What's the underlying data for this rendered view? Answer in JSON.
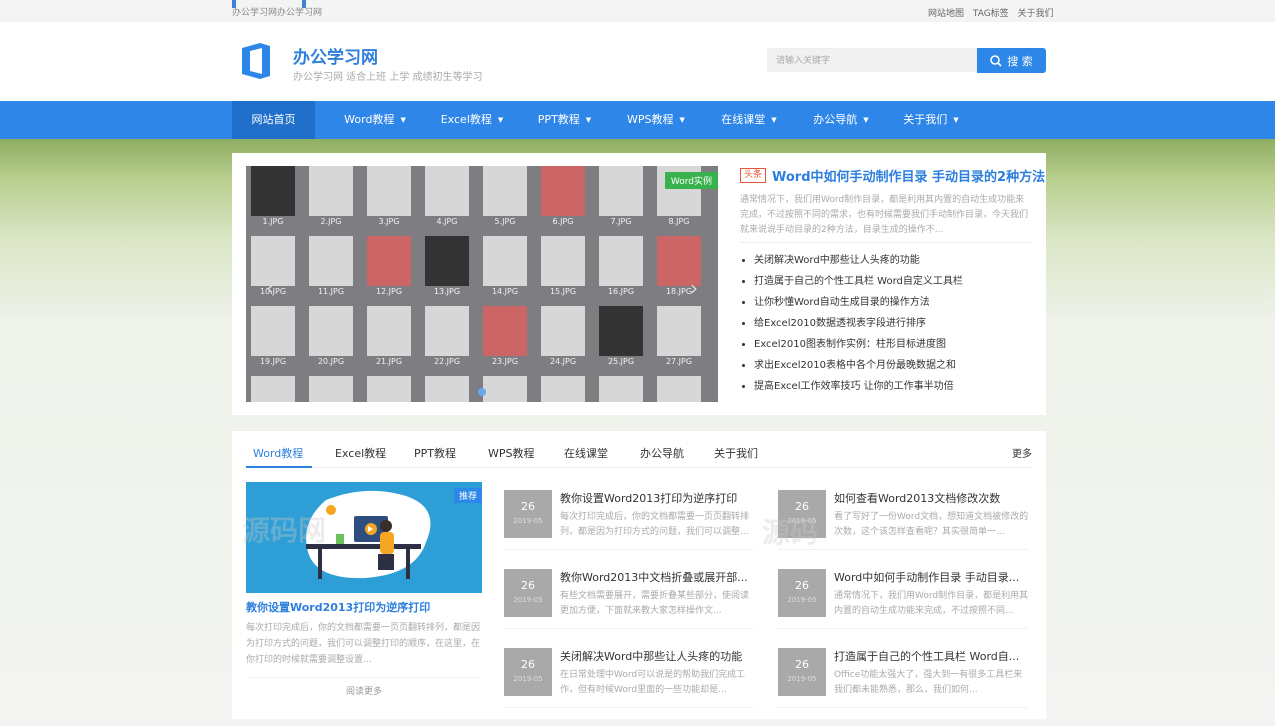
{
  "topbar": {
    "site_name": "办公学习网办公学习网",
    "links": [
      "网站地图",
      "TAG标签",
      "关于我们"
    ]
  },
  "header": {
    "title": "办公学习网",
    "subtitle": "办公学习网 适合上班 上学 成绩初生等学习",
    "search_placeholder": "请输入关键字",
    "search_button": "搜 索"
  },
  "nav": {
    "items": [
      {
        "label": "网站首页",
        "dropdown": false,
        "active": true
      },
      {
        "label": "Word教程",
        "dropdown": true
      },
      {
        "label": "Excel教程",
        "dropdown": true
      },
      {
        "label": "PPT教程",
        "dropdown": true
      },
      {
        "label": "WPS教程",
        "dropdown": true
      },
      {
        "label": "在线课堂",
        "dropdown": true
      },
      {
        "label": "办公导航",
        "dropdown": true
      },
      {
        "label": "关于我们",
        "dropdown": true
      }
    ]
  },
  "slider": {
    "tag": "Word实例",
    "thumb_labels": [
      "1.JPG",
      "2.JPG",
      "3.JPG",
      "4.JPG",
      "5.JPG",
      "6.JPG",
      "7.JPG",
      "8.JPG",
      "10.JPG",
      "11.JPG",
      "12.JPG",
      "13.JPG",
      "14.JPG",
      "15.JPG",
      "16.JPG",
      "18.JPG",
      "19.JPG",
      "20.JPG",
      "21.JPG",
      "22.JPG",
      "23.JPG",
      "24.JPG",
      "25.JPG",
      "27.JPG"
    ]
  },
  "headline": {
    "badge": "头条",
    "title": "Word中如何手动制作目录 手动目录的2种方法",
    "desc": "通常情况下，我们用Word制作目录，都是利用其内置的自动生成功能来完成，不过按照不同的需求，也有时候需要我们手动制作目录，今天我们就来说说手动目录的2种方法，目录生成的操作不..."
  },
  "news": [
    "关闭解决Word中那些让人头疼的功能",
    "打造属于自己的个性工具栏 Word自定义工具栏",
    "让你秒懂Word自动生成目录的操作方法",
    "给Excel2010数据透视表字段进行排序",
    "Excel2010图表制作实例：柱形目标进度图",
    "求出Excel2010表格中各个月份最晚数据之和",
    "提高Excel工作效率技巧 让你的工作事半功倍"
  ],
  "tabs": {
    "items": [
      "Word教程",
      "Excel教程",
      "PPT教程",
      "WPS教程",
      "在线课堂",
      "办公导航",
      "关于我们"
    ],
    "more": "更多"
  },
  "feature": {
    "tag": "推荐",
    "title": "教你设置Word2013打印为逆序打印",
    "desc": "每次打印完成后，你的文档都需要一页页翻转排列，都是因为打印方式的问题，我们可以调整打印的顺序，在这里，在你打印的时候就需要调整设置...",
    "more": "阅读更多"
  },
  "articles": [
    {
      "day": "26",
      "month": "2019-05",
      "title": "教你设置Word2013打印为逆序打印",
      "desc": "每次打印完成后，你的文档都需要一页页翻转排列，都是因为打印方式的问题，我们可以调整..."
    },
    {
      "day": "26",
      "month": "2019-05",
      "title": "如何查看Word2013文档修改次数",
      "desc": "看了写好了一份Word文档，想知道文档被修改的次数，这个该怎样查看呢？其实很简单一..."
    },
    {
      "day": "26",
      "month": "2019-05",
      "title": "教你Word2013中文档折叠或展开部...",
      "desc": "有些文档需要展开，需要折叠某些部分，使阅读更加方便，下面就来教大家怎样操作文..."
    },
    {
      "day": "26",
      "month": "2019-05",
      "title": "Word中如何手动制作目录 手动目录...",
      "desc": "通常情况下，我们用Word制作目录，都是利用其内置的自动生成功能来完成，不过按照不同..."
    },
    {
      "day": "26",
      "month": "2019-05",
      "title": "关闭解决Word中那些让人头疼的功能",
      "desc": "在日常处理中Word可以说是的帮助我们完成工作，但有时候Word里面的一些功能却是..."
    },
    {
      "day": "26",
      "month": "2019-05",
      "title": "打造属于自己的个性工具栏 Word自...",
      "desc": "Office功能太强大了，强大到一有很多工具栏来我们都未能熟悉，那么，我们如何..."
    }
  ],
  "watermarks": [
    "源码网",
    "源码"
  ],
  "colors": {
    "primary": "#2e86e8",
    "nav_active": "#1f6fcb",
    "headline_badge": "#e4553a",
    "slider_tag": "#37b24d"
  }
}
